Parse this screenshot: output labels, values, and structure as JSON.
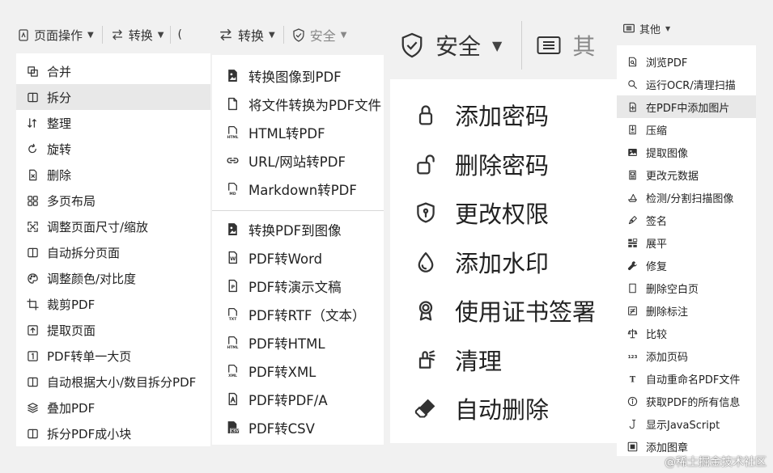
{
  "panel1": {
    "toolbar": [
      {
        "icon": "page-ops-icon",
        "label": "页面操作"
      },
      {
        "icon": "convert-icon",
        "label": "转换"
      },
      {
        "icon": "partial-icon",
        "label": ""
      }
    ],
    "items": [
      {
        "icon": "merge-icon",
        "label": "合并"
      },
      {
        "icon": "split-icon",
        "label": "拆分"
      },
      {
        "icon": "sort-icon",
        "label": "整理"
      },
      {
        "icon": "rotate-icon",
        "label": "旋转"
      },
      {
        "icon": "delete-icon",
        "label": "删除"
      },
      {
        "icon": "multi-page-icon",
        "label": "多页布局"
      },
      {
        "icon": "resize-icon",
        "label": "调整页面尺寸/缩放"
      },
      {
        "icon": "auto-split-icon",
        "label": "自动拆分页面"
      },
      {
        "icon": "palette-icon",
        "label": "调整颜色/对比度"
      },
      {
        "icon": "crop-icon",
        "label": "裁剪PDF"
      },
      {
        "icon": "extract-page-icon",
        "label": "提取页面"
      },
      {
        "icon": "single-page-icon",
        "label": "PDF转单一大页"
      },
      {
        "icon": "auto-split-size-icon",
        "label": "自动根据大小/数目拆分PDF"
      },
      {
        "icon": "overlay-icon",
        "label": "叠加PDF"
      },
      {
        "icon": "split-chunks-icon",
        "label": "拆分PDF成小块"
      }
    ]
  },
  "panel2": {
    "toolbar": [
      {
        "icon": "convert-icon",
        "label": "转换"
      },
      {
        "icon": "shield-icon",
        "label": "安全"
      }
    ],
    "group1": [
      {
        "icon": "image-icon",
        "label": "转换图像到PDF"
      },
      {
        "icon": "file-icon",
        "label": "将文件转换为PDF文件"
      },
      {
        "icon": "html-icon",
        "label": "HTML转PDF"
      },
      {
        "icon": "link-icon",
        "label": "URL/网站转PDF"
      },
      {
        "icon": "markdown-icon",
        "label": "Markdown转PDF"
      }
    ],
    "group2": [
      {
        "icon": "image-icon",
        "label": "转换PDF到图像"
      },
      {
        "icon": "word-icon",
        "label": "PDF转Word"
      },
      {
        "icon": "ppt-icon",
        "label": "PDF转演示文稿"
      },
      {
        "icon": "txt-icon",
        "label": "PDF转RTF（文本）"
      },
      {
        "icon": "html-icon",
        "label": "PDF转HTML"
      },
      {
        "icon": "xml-icon",
        "label": "PDF转XML"
      },
      {
        "icon": "pdfa-icon",
        "label": "PDF转PDF/A"
      },
      {
        "icon": "csv-icon",
        "label": "PDF转CSV"
      }
    ]
  },
  "panel3": {
    "toolbar": [
      {
        "icon": "shield-icon",
        "label": "安全"
      },
      {
        "icon": "list-icon",
        "label": "其"
      }
    ],
    "items": [
      {
        "icon": "lock-icon",
        "label": "添加密码"
      },
      {
        "icon": "unlock-icon",
        "label": "删除密码"
      },
      {
        "icon": "permission-icon",
        "label": "更改权限"
      },
      {
        "icon": "water-drop-icon",
        "label": "添加水印"
      },
      {
        "icon": "certificate-icon",
        "label": "使用证书签署"
      },
      {
        "icon": "clean-icon",
        "label": "清理"
      },
      {
        "icon": "eraser-icon",
        "label": "自动删除"
      }
    ]
  },
  "panel4": {
    "toolbar": [
      {
        "icon": "list-icon",
        "label": "其他"
      }
    ],
    "items": [
      {
        "icon": "view-pdf-icon",
        "label": "浏览PDF"
      },
      {
        "icon": "search-icon",
        "label": "运行OCR/清理扫描"
      },
      {
        "icon": "add-image-icon",
        "label": "在PDF中添加图片"
      },
      {
        "icon": "compress-icon",
        "label": "压缩"
      },
      {
        "icon": "extract-image-icon",
        "label": "提取图像"
      },
      {
        "icon": "metadata-icon",
        "label": "更改元数据"
      },
      {
        "icon": "scan-detect-icon",
        "label": "检测/分割扫描图像"
      },
      {
        "icon": "sign-icon",
        "label": "签名"
      },
      {
        "icon": "flatten-icon",
        "label": "展平"
      },
      {
        "icon": "repair-icon",
        "label": "修复"
      },
      {
        "icon": "blank-page-icon",
        "label": "删除空白页"
      },
      {
        "icon": "annotation-icon",
        "label": "删除标注"
      },
      {
        "icon": "compare-icon",
        "label": "比较"
      },
      {
        "icon": "page-number-icon",
        "label": "添加页码"
      },
      {
        "icon": "rename-icon",
        "label": "自动重命名PDF文件"
      },
      {
        "icon": "info-icon",
        "label": "获取PDF的所有信息"
      },
      {
        "icon": "javascript-icon",
        "label": "显示JavaScript"
      },
      {
        "icon": "stamp-icon",
        "label": "添加图章"
      }
    ]
  },
  "watermark": "@稀土掘金技术社区"
}
